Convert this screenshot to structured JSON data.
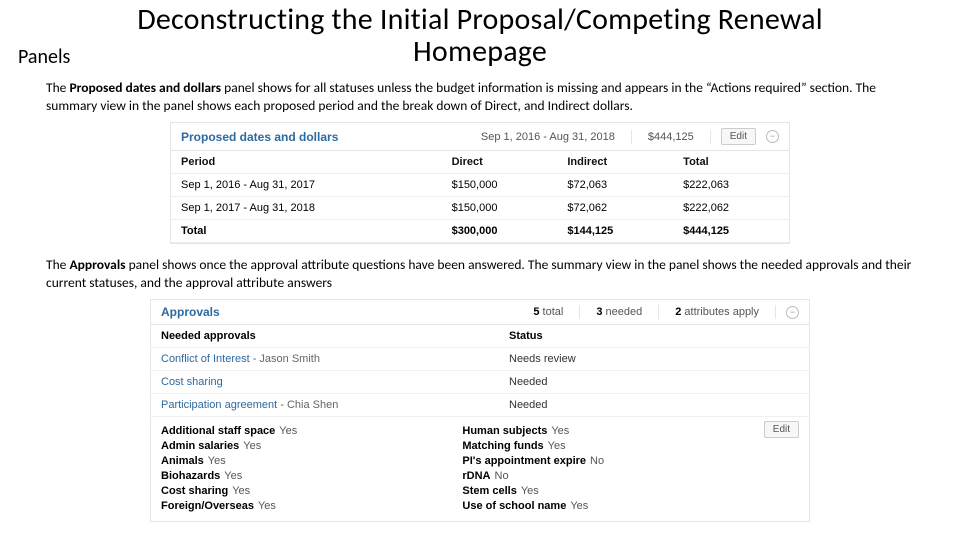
{
  "title": {
    "line1": "Deconstructing the Initial Proposal/Competing Renewal",
    "line2": "Homepage",
    "sub": "Panels"
  },
  "para1_pre": "The ",
  "para1_bold": "Proposed dates and dollars",
  "para1_post": " panel shows for all statuses unless the budget information is missing and appears in the “Actions required” section. The summary view in the panel shows each proposed period and the break down of Direct, and Indirect dollars.",
  "dollars": {
    "title": "Proposed dates and dollars",
    "hdr_dates": "Sep 1, 2016 - Aug 31, 2018",
    "hdr_total": "$444,125",
    "edit": "Edit",
    "cols": {
      "period": "Period",
      "direct": "Direct",
      "indirect": "Indirect",
      "total": "Total"
    },
    "rows": [
      {
        "period": "Sep 1, 2016 - Aug 31, 2017",
        "direct": "$150,000",
        "indirect": "$72,063",
        "total": "$222,063"
      },
      {
        "period": "Sep 1, 2017 - Aug 31, 2018",
        "direct": "$150,000",
        "indirect": "$72,062",
        "total": "$222,062"
      }
    ],
    "totalrow": {
      "label": "Total",
      "direct": "$300,000",
      "indirect": "$144,125",
      "total": "$444,125"
    }
  },
  "para2_pre": "The ",
  "para2_bold": "Approvals",
  "para2_post": " panel shows once the approval attribute questions have been answered. The summary view in the panel shows the needed approvals and their current statuses, and the approval attribute answers",
  "approvals": {
    "title": "Approvals",
    "hdr_total_n": "5",
    "hdr_total_l": " total",
    "hdr_needed_n": "3",
    "hdr_needed_l": " needed",
    "hdr_attr_n": "2",
    "hdr_attr_l": " attributes apply",
    "subcol1": "Needed approvals",
    "subcol2": "Status",
    "rows": [
      {
        "link": "Conflict of Interest",
        "suffix": " - Jason Smith",
        "status": "Needs review"
      },
      {
        "link": "Cost sharing",
        "suffix": "",
        "status": "Needed"
      },
      {
        "link": "Participation agreement",
        "suffix": " - Chia Shen",
        "status": "Needed"
      }
    ],
    "left": [
      {
        "k": "Additional staff space",
        "v": "Yes"
      },
      {
        "k": "Admin salaries",
        "v": "Yes"
      },
      {
        "k": "Animals",
        "v": "Yes"
      },
      {
        "k": "Biohazards",
        "v": "Yes"
      },
      {
        "k": "Cost sharing",
        "v": "Yes"
      },
      {
        "k": "Foreign/Overseas",
        "v": "Yes"
      }
    ],
    "right": [
      {
        "k": "Human subjects",
        "v": "Yes"
      },
      {
        "k": "Matching funds",
        "v": "Yes"
      },
      {
        "k": "PI's appointment expire",
        "v": "No"
      },
      {
        "k": "rDNA",
        "v": "No"
      },
      {
        "k": "Stem cells",
        "v": "Yes"
      },
      {
        "k": "Use of school name",
        "v": "Yes"
      }
    ],
    "edit": "Edit"
  }
}
